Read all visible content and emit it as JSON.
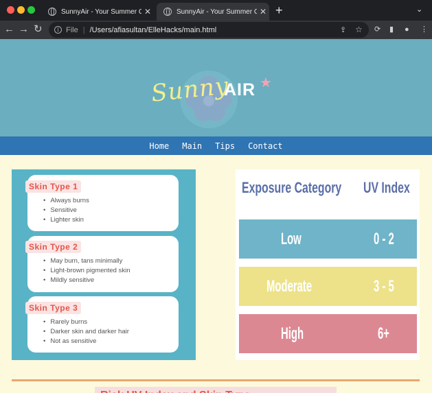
{
  "browser": {
    "tabs": [
      {
        "title": "SunnyAir - Your Summer Comp",
        "active": false
      },
      {
        "title": "SunnyAir - Your Summer Comp",
        "active": true
      }
    ],
    "address": {
      "scheme": "File",
      "url": "/Users/afiasultan/ElleHacks/main.html"
    }
  },
  "site": {
    "logo": {
      "part1": "Sunny",
      "part2": "AIR"
    },
    "nav": [
      "Home",
      "Main",
      "Tips",
      "Contact"
    ]
  },
  "skin_types": [
    {
      "title": "Skin Type 1",
      "traits": [
        "Always burns",
        "Sensitive",
        "Lighter skin"
      ]
    },
    {
      "title": "Skin Type 2",
      "traits": [
        "May burn, tans minimally",
        "Light-brown pigmented skin",
        "Mildly sensitive"
      ]
    },
    {
      "title": "Skin Type 3",
      "traits": [
        "Rarely burns",
        "Darker skin and darker hair",
        "Not as sensitive"
      ]
    }
  ],
  "uv_table": {
    "headers": {
      "category": "Exposure Category",
      "index": "UV Index"
    },
    "rows": [
      {
        "category": "Low",
        "index": "0 - 2",
        "color": "#6fb4c8"
      },
      {
        "category": "Moderate",
        "index": "3 - 5",
        "color": "#ede28a"
      },
      {
        "category": "High",
        "index": "6+",
        "color": "#dc8892"
      }
    ]
  },
  "bottom_heading": "Risk UV Index and Skin Type",
  "colors": {
    "hero": "#6aaec0",
    "nav": "#2f74b3",
    "page_bg": "#fdf9dd",
    "skin_panel": "#58b3c6",
    "accent_red": "#e2564b"
  }
}
